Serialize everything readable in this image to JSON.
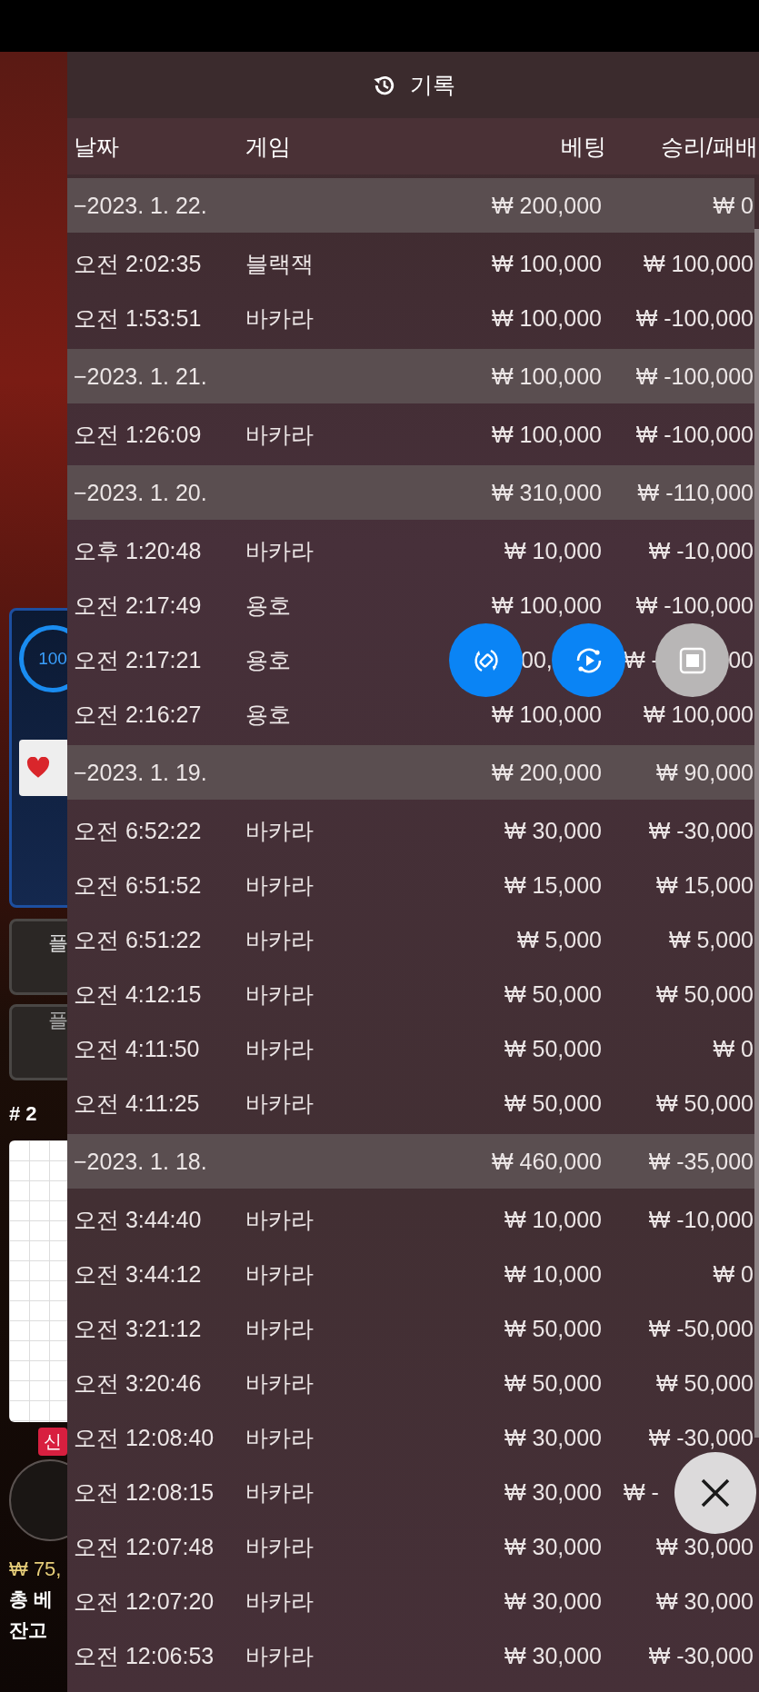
{
  "title": "기록",
  "columns": [
    "날짜",
    "게임",
    "베팅",
    "승리/패배"
  ],
  "groups": [
    {
      "date": "−2023. 1. 22.",
      "bet": "₩ 200,000",
      "result": "₩ 0",
      "rows": [
        {
          "time": "오전 2:02:35",
          "game": "블랙잭",
          "bet": "₩ 100,000",
          "result": "₩ 100,000"
        },
        {
          "time": "오전 1:53:51",
          "game": "바카라",
          "bet": "₩ 100,000",
          "result": "₩ -100,000"
        }
      ]
    },
    {
      "date": "−2023. 1. 21.",
      "bet": "₩ 100,000",
      "result": "₩ -100,000",
      "rows": [
        {
          "time": "오전 1:26:09",
          "game": "바카라",
          "bet": "₩ 100,000",
          "result": "₩ -100,000"
        }
      ]
    },
    {
      "date": "−2023. 1. 20.",
      "bet": "₩ 310,000",
      "result": "₩ -110,000",
      "rows": [
        {
          "time": "오후 1:20:48",
          "game": "바카라",
          "bet": "₩ 10,000",
          "result": "₩ -10,000"
        },
        {
          "time": "오전 2:17:49",
          "game": "용호",
          "bet": "₩ 100,000",
          "result": "₩ -100,000"
        },
        {
          "time": "오전 2:17:21",
          "game": "용호",
          "bet": "00,",
          "result": "₩ -",
          "result_tail": "00",
          "covered": true
        },
        {
          "time": "오전 2:16:27",
          "game": "용호",
          "bet": "₩ 100,000",
          "result": "₩ 100,000"
        }
      ]
    },
    {
      "date": "−2023. 1. 19.",
      "bet": "₩ 200,000",
      "result": "₩ 90,000",
      "rows": [
        {
          "time": "오전 6:52:22",
          "game": "바카라",
          "bet": "₩ 30,000",
          "result": "₩ -30,000"
        },
        {
          "time": "오전 6:51:52",
          "game": "바카라",
          "bet": "₩ 15,000",
          "result": "₩ 15,000"
        },
        {
          "time": "오전 6:51:22",
          "game": "바카라",
          "bet": "₩ 5,000",
          "result": "₩ 5,000"
        },
        {
          "time": "오전 4:12:15",
          "game": "바카라",
          "bet": "₩ 50,000",
          "result": "₩ 50,000"
        },
        {
          "time": "오전 4:11:50",
          "game": "바카라",
          "bet": "₩ 50,000",
          "result": "₩ 0"
        },
        {
          "time": "오전 4:11:25",
          "game": "바카라",
          "bet": "₩ 50,000",
          "result": "₩ 50,000"
        }
      ]
    },
    {
      "date": "−2023. 1. 18.",
      "bet": "₩ 460,000",
      "result": "₩ -35,000",
      "rows": [
        {
          "time": "오전 3:44:40",
          "game": "바카라",
          "bet": "₩ 10,000",
          "result": "₩ -10,000"
        },
        {
          "time": "오전 3:44:12",
          "game": "바카라",
          "bet": "₩ 10,000",
          "result": "₩ 0"
        },
        {
          "time": "오전 3:21:12",
          "game": "바카라",
          "bet": "₩ 50,000",
          "result": "₩ -50,000"
        },
        {
          "time": "오전 3:20:46",
          "game": "바카라",
          "bet": "₩ 50,000",
          "result": "₩ 50,000"
        },
        {
          "time": "오전 12:08:40",
          "game": "바카라",
          "bet": "₩ 30,000",
          "result": "₩ -30,000"
        },
        {
          "time": "오전 12:08:15",
          "game": "바카라",
          "bet": "₩ 30,000",
          "result": "₩ -",
          "covered": true
        },
        {
          "time": "오전 12:07:48",
          "game": "바카라",
          "bet": "₩ 30,000",
          "result": "₩ 30,000"
        },
        {
          "time": "오전 12:07:20",
          "game": "바카라",
          "bet": "₩ 30,000",
          "result": "₩ 30,000"
        },
        {
          "time": "오전 12:06:53",
          "game": "바카라",
          "bet": "₩ 30,000",
          "result": "₩ -30,000"
        }
      ]
    }
  ],
  "background_app": {
    "timer": "100",
    "buttons": [
      "플",
      "플"
    ],
    "table_number": "# 2",
    "badge": "신",
    "balance": "₩ 75,",
    "total_bet": "총 베",
    "balance_label": "잔고"
  }
}
